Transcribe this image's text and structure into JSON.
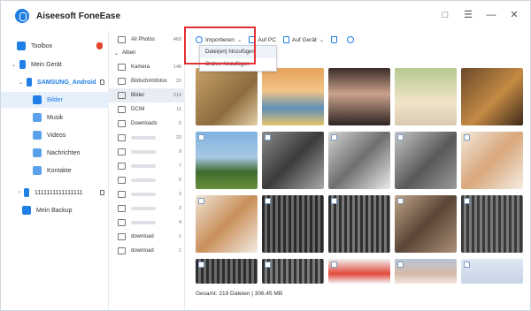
{
  "app": {
    "title": "Aiseesoft FoneEase"
  },
  "window_controls": [
    "feedback-icon",
    "menu-icon",
    "minimize-icon",
    "close-icon"
  ],
  "sidebar": {
    "items": [
      {
        "label": "Toolbox",
        "icon": "toolbox-icon"
      },
      {
        "label": "Mein Gerät",
        "icon": "device-icon"
      },
      {
        "label": "SAMSUNG_Android",
        "icon": "phone-icon"
      },
      {
        "label": "Bilder",
        "icon": "photos-icon"
      },
      {
        "label": "Musik",
        "icon": "music-icon"
      },
      {
        "label": "Videos",
        "icon": "video-icon"
      },
      {
        "label": "Nachrichten",
        "icon": "message-icon"
      },
      {
        "label": "Kontakte",
        "icon": "contact-icon"
      },
      {
        "label": "1111111111111111",
        "icon": "phone-icon"
      },
      {
        "label": "Mein Backup",
        "icon": "backup-icon"
      }
    ]
  },
  "folders": {
    "all_photos": {
      "label": "All Photos",
      "count": "460"
    },
    "albums_header": "Alben",
    "rows": [
      {
        "label": "Kamera",
        "count": "148"
      },
      {
        "label": "Bildschirmfotos",
        "count": "20"
      },
      {
        "label": "Bilder",
        "count": "219"
      },
      {
        "label": "DCIM",
        "count": "11"
      },
      {
        "label": "Downloads",
        "count": "0"
      },
      {
        "label": "",
        "count": "33"
      },
      {
        "label": "",
        "count": "9"
      },
      {
        "label": "",
        "count": "7"
      },
      {
        "label": "",
        "count": "5"
      },
      {
        "label": "",
        "count": "2"
      },
      {
        "label": "",
        "count": "3"
      },
      {
        "label": "",
        "count": "4"
      },
      {
        "label": "download",
        "count": "1"
      },
      {
        "label": "download",
        "count": "1"
      }
    ]
  },
  "toolbar": {
    "import_label": "Importieren",
    "to_pc_label": "Auf PC",
    "to_device_label": "Auf Gerät"
  },
  "dropdown": {
    "items": [
      "Datei(en) hinzufügen",
      "Ordner hinzufügen"
    ]
  },
  "status": {
    "text": "Gesamt: 219 Dateien | 306.45 MB"
  }
}
